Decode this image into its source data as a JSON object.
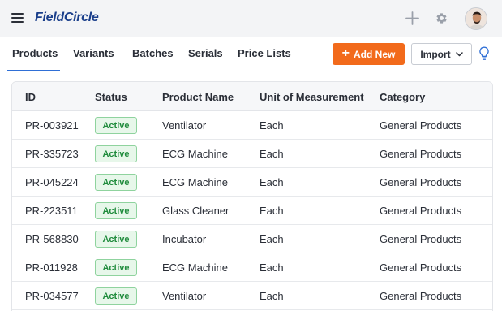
{
  "header": {
    "logo_text": "FieldCircle",
    "menu_icon": "hamburger-menu-icon",
    "add_icon": "plus-icon",
    "settings_icon": "gear-icon",
    "avatar_icon": "user-avatar"
  },
  "tabs": [
    {
      "label": "Products",
      "active": true
    },
    {
      "label": "Variants",
      "active": false
    },
    {
      "label": "Batches",
      "active": false
    },
    {
      "label": "Serials",
      "active": false
    },
    {
      "label": "Price Lists",
      "active": false
    }
  ],
  "toolbar": {
    "add_new_label": "Add New",
    "import_label": "Import",
    "tips_icon": "lightbulb-icon"
  },
  "table": {
    "columns": [
      "ID",
      "Status",
      "Product Name",
      "Unit of Measurement",
      "Category"
    ],
    "rows": [
      {
        "id": "PR-003921",
        "status": "Active",
        "name": "Ventilator",
        "uom": "Each",
        "category": "General Products"
      },
      {
        "id": "PR-335723",
        "status": "Active",
        "name": "ECG Machine",
        "uom": "Each",
        "category": "General Products"
      },
      {
        "id": "PR-045224",
        "status": "Active",
        "name": "ECG Machine",
        "uom": "Each",
        "category": "General Products"
      },
      {
        "id": "PR-223511",
        "status": "Active",
        "name": "Glass Cleaner",
        "uom": "Each",
        "category": "General Products"
      },
      {
        "id": "PR-568830",
        "status": "Active",
        "name": "Incubator",
        "uom": "Each",
        "category": "General Products"
      },
      {
        "id": "PR-011928",
        "status": "Active",
        "name": "ECG Machine",
        "uom": "Each",
        "category": "General Products"
      },
      {
        "id": "PR-034577",
        "status": "Active",
        "name": "Ventilator",
        "uom": "Each",
        "category": "General Products"
      }
    ]
  },
  "colors": {
    "accent_orange": "#f26a1b",
    "brand_blue": "#1b3f8b",
    "tab_underline": "#2f6fd6",
    "status_green": "#1f8b3c"
  }
}
